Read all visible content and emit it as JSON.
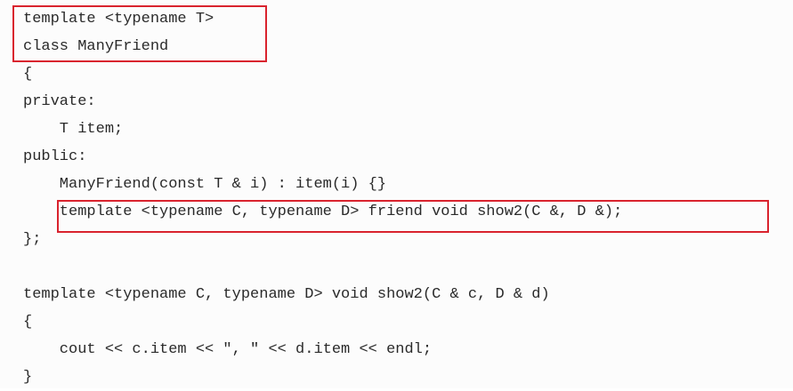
{
  "code_lines": [
    "template <typename T>",
    "class ManyFriend",
    "{",
    "private:",
    "    T item;",
    "public:",
    "    ManyFriend(const T & i) : item(i) {}",
    "    template <typename C, typename D> friend void show2(C &, D &);",
    "};",
    "",
    "template <typename C, typename D> void show2(C & c, D & d)",
    "{",
    "    cout << c.item << \", \" << d.item << endl;",
    "}"
  ],
  "colors": {
    "text": "#2a2a2a",
    "highlight_border": "#d9232e",
    "background": "#fcfcfc"
  }
}
